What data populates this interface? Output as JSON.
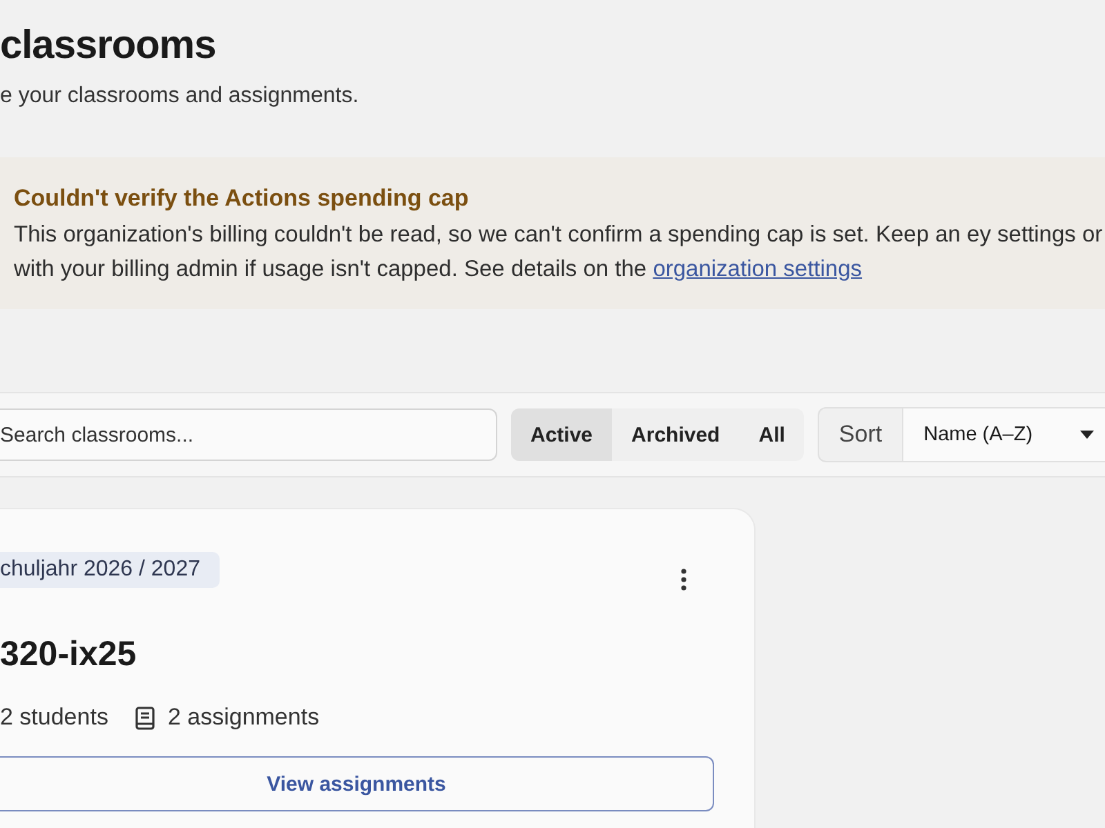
{
  "header": {
    "title": "classrooms",
    "subtitle": "e your classrooms and assignments."
  },
  "banner": {
    "title": "Couldn't verify the Actions spending cap",
    "text": "This organization's billing couldn't be read, so we can't confirm a spending cap is set. Keep an ey settings or with your billing admin if usage isn't capped. See details on the",
    "link": "organization settings"
  },
  "toolbar": {
    "search": {
      "placeholder": "Search classrooms..."
    },
    "filters": [
      {
        "label": "Active",
        "selected": true
      },
      {
        "label": "Archived",
        "selected": false
      },
      {
        "label": "All",
        "selected": false
      }
    ],
    "sort": {
      "label": "Sort",
      "value": "Name (A–Z)"
    }
  },
  "classrooms": [
    {
      "tag": "chuljahr 2026 / 2027",
      "name": "320-ix25",
      "students": "2 students",
      "assignments": "2 assignments",
      "action": "View assignments"
    }
  ]
}
